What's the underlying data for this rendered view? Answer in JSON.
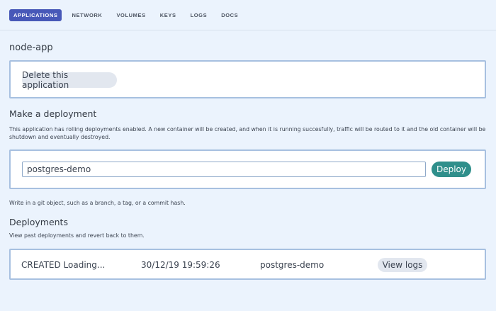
{
  "nav": {
    "tabs": [
      {
        "label": "APPLICATIONS",
        "active": true
      },
      {
        "label": "NETWORK",
        "active": false
      },
      {
        "label": "VOLUMES",
        "active": false
      },
      {
        "label": "KEYS",
        "active": false
      },
      {
        "label": "LOGS",
        "active": false
      },
      {
        "label": "DOCS",
        "active": false
      }
    ]
  },
  "app": {
    "name": "node-app",
    "delete_label": "Delete this application"
  },
  "deploy": {
    "title": "Make a deployment",
    "description": "This application has rolling deployments enabled. A new container will be created, and when it is running succesfully, traffic will be routed to it and the old container will be shutdown and eventually destroyed.",
    "input_value": "postgres-demo",
    "button_label": "Deploy",
    "hint": "Write in a git object, such as a branch, a tag, or a commit hash."
  },
  "deployments": {
    "title": "Deployments",
    "description": "View past deployments and revert back to them.",
    "rows": [
      {
        "status": "CREATED Loading...",
        "timestamp": "30/12/19 19:59:26",
        "commit": "postgres-demo",
        "logs_label": "View logs"
      }
    ]
  },
  "colors": {
    "background": "#ebf3fd",
    "active_tab": "#4758b8",
    "card_border": "#a7c0e0",
    "deploy_button": "#2f8f8b",
    "pill_button": "#e2e7ef"
  }
}
